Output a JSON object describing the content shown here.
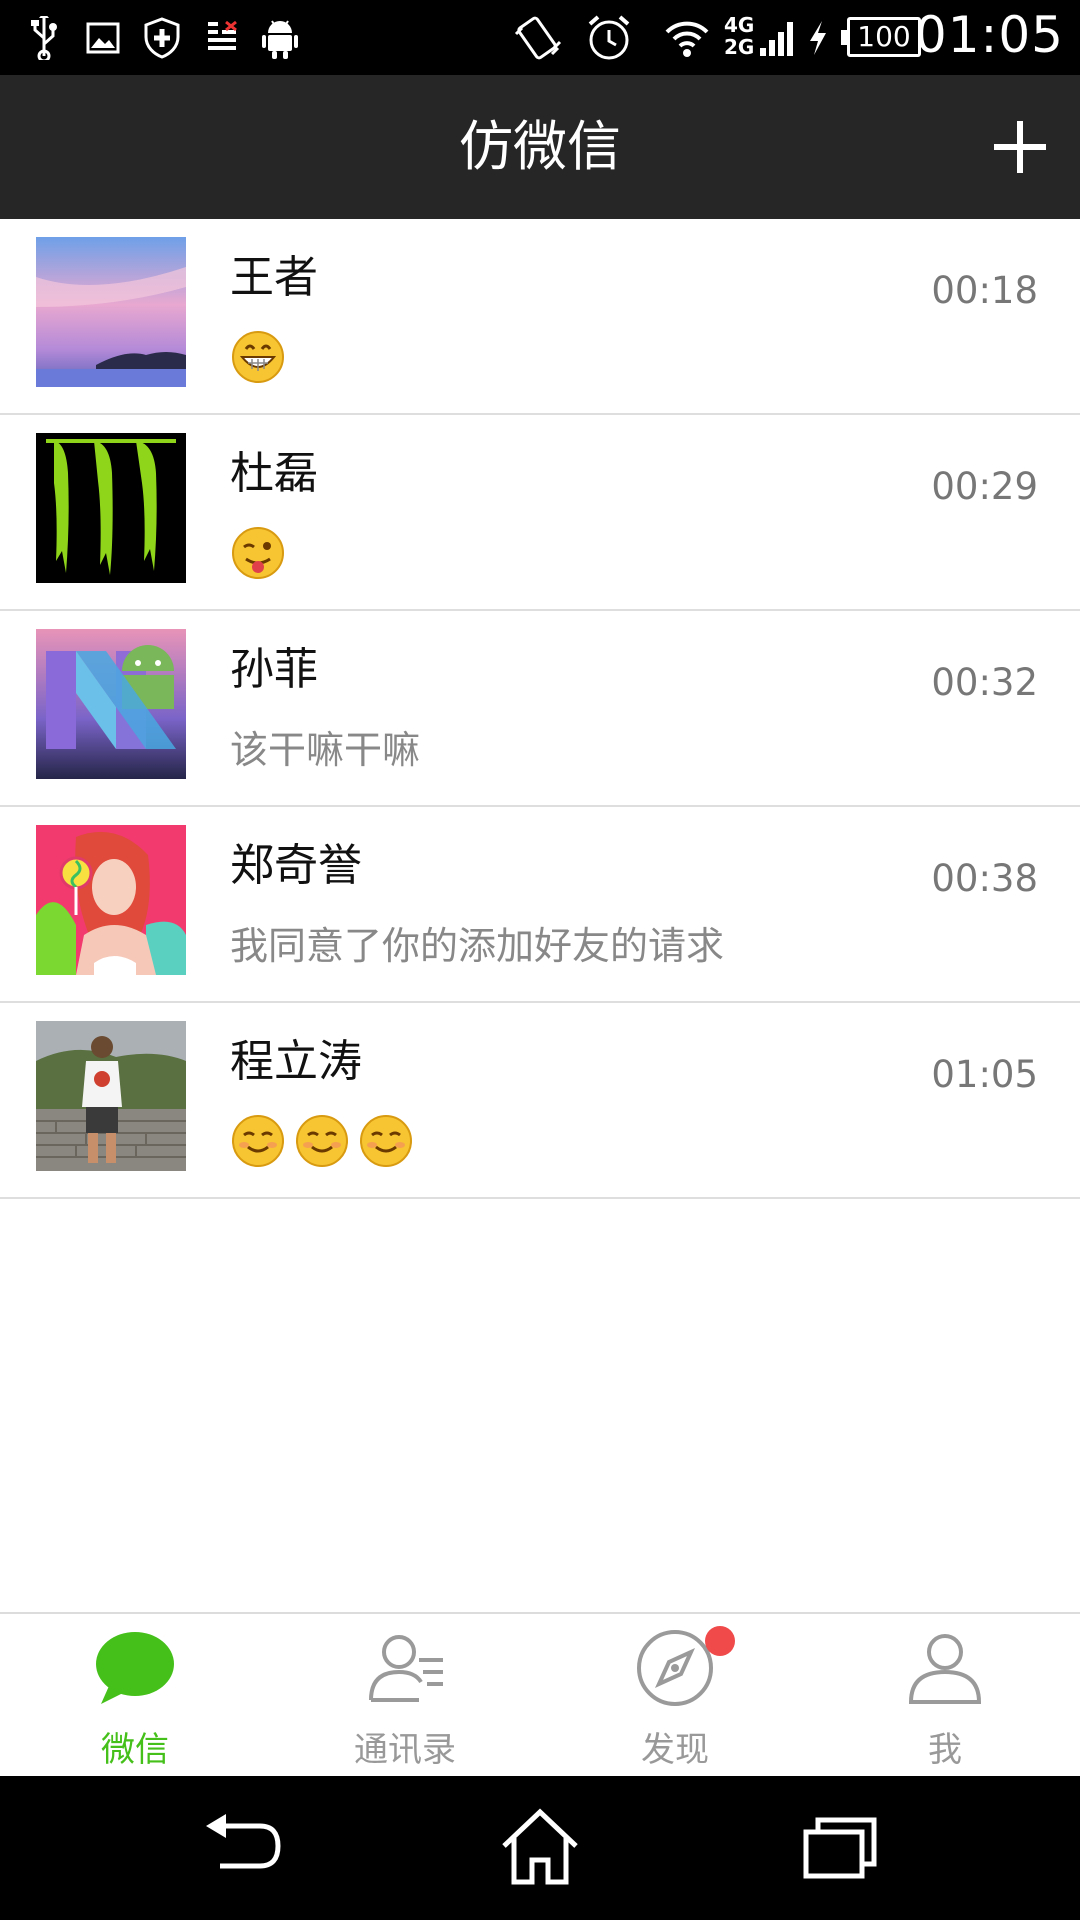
{
  "status_bar": {
    "time": "01:05",
    "battery": "100",
    "network_top": "4G",
    "network_bottom": "2G",
    "icons": [
      "usb-icon",
      "image-icon",
      "shield-icon",
      "data-icon",
      "android-icon",
      "vibrate-icon",
      "alarm-icon",
      "wifi-icon",
      "signal-icon",
      "charging-icon"
    ]
  },
  "header": {
    "title": "仿微信",
    "add_icon": "plus-icon"
  },
  "chats": [
    {
      "name": "王者",
      "time": "00:18",
      "message": "",
      "emojis": [
        "grin"
      ],
      "avatar": "sunset-lake-photo"
    },
    {
      "name": "杜磊",
      "time": "00:29",
      "message": "",
      "emojis": [
        "wink-tongue"
      ],
      "avatar": "green-claw-logo"
    },
    {
      "name": "孙菲",
      "time": "00:32",
      "message": "该干嘛干嘛",
      "emojis": [],
      "avatar": "android-n-logo"
    },
    {
      "name": "郑奇誉",
      "time": "00:38",
      "message": "我同意了你的添加好友的请求",
      "emojis": [],
      "avatar": "woman-lollipop-photo"
    },
    {
      "name": "程立涛",
      "time": "01:05",
      "message": "",
      "emojis": [
        "smile",
        "smile",
        "smile"
      ],
      "avatar": "man-great-wall-photo"
    }
  ],
  "tabs": [
    {
      "label": "微信",
      "icon": "chat-bubble-icon",
      "active": true
    },
    {
      "label": "通讯录",
      "icon": "contacts-icon",
      "active": false
    },
    {
      "label": "发现",
      "icon": "compass-icon",
      "active": false,
      "badge": true
    },
    {
      "label": "我",
      "icon": "person-icon",
      "active": false
    }
  ],
  "colors": {
    "title_bar": "#262626",
    "accent_green": "#45c01a",
    "badge_red": "#f04a4a",
    "inactive_gray": "#999999"
  },
  "nav": [
    "back-icon",
    "home-icon",
    "recents-icon"
  ]
}
